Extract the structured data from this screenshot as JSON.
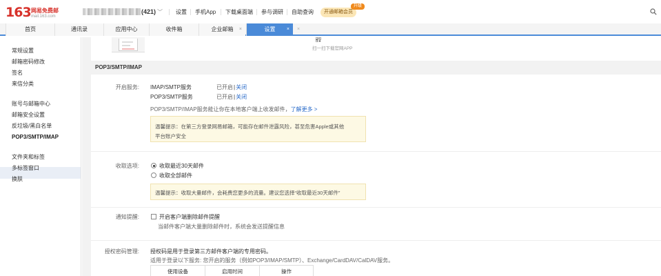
{
  "header": {
    "logo_number": "163",
    "logo_cn": "网易免费邮",
    "logo_domain": "mail.163.com",
    "unread_count": "(421)",
    "links": [
      "设置",
      "手机App",
      "下载桌面端",
      "参与调研",
      "自助查询"
    ],
    "vip_label": "开通邮箱会员",
    "vip_badge": "升级"
  },
  "tabs": [
    {
      "label": "首页",
      "closable": false,
      "active": false
    },
    {
      "label": "通讯录",
      "closable": false,
      "active": false
    },
    {
      "label": "应用中心",
      "closable": false,
      "active": false
    },
    {
      "label": "收件箱",
      "closable": false,
      "active": false
    },
    {
      "label": "企业邮箱",
      "closable": true,
      "active": false
    },
    {
      "label": "设置",
      "closable": true,
      "active": true
    }
  ],
  "tab_close_glyph": "×",
  "sidebar": {
    "groups": [
      [
        "常规设置",
        "邮箱密码修改",
        "签名",
        "来信分类"
      ],
      [
        "账号与邮箱中心",
        "邮箱安全设置",
        "反垃圾/黑白名单",
        "POP3/SMTP/IMAP"
      ],
      [
        "文件夹和标签",
        "多标签窗口",
        "换肤"
      ]
    ],
    "active_item": "POP3/SMTP/IMAP"
  },
  "qr_hint": "扫一扫下载官网APP",
  "section_title": "POP3/SMTP/IMAP",
  "services": {
    "label": "开启服务:",
    "rows": [
      {
        "name": "IMAP/SMTP服务",
        "status": "已开启",
        "action": "关闭"
      },
      {
        "name": "POP3/SMTP服务",
        "status": "已开启",
        "action": "关闭"
      }
    ],
    "desc": "POP3/SMTP/IMAP服务能让你在本地客户端上收发邮件，",
    "learn_more": "了解更多 >",
    "tip_line1": "温馨提示：在第三方登录网易邮箱，可能存在邮件泄露风险，甚至危害Apple或其他",
    "tip_line2": "平台账户安全"
  },
  "receive": {
    "label": "收取选项:",
    "options": [
      {
        "label": "收取最近30天邮件",
        "checked": true
      },
      {
        "label": "收取全部邮件",
        "checked": false
      }
    ],
    "tip": "温馨提示：收取大量邮件，会耗费您更多的流量。建议您选择“收取最近30天邮件”"
  },
  "notify": {
    "label": "通知提醒:",
    "checkbox_label": "开启客户端删除邮件提醒",
    "desc": "当邮件客户端大量删除邮件时，系统会发送提醒信息"
  },
  "auth": {
    "label": "授权密码管理:",
    "desc1": "授权码是用于登录第三方邮件客户端的专用密码。",
    "desc2": "适用于登录以下服务: 您开启的服务（例如POP3/IMAP/SMTP）、Exchange/CardDAV/CalDAV服务。",
    "columns": [
      "使用设备",
      "启用时间",
      "操作"
    ]
  },
  "colors": {
    "brand": "#d7312a",
    "accent": "#4a8ad8",
    "link": "#2a6bc9"
  }
}
